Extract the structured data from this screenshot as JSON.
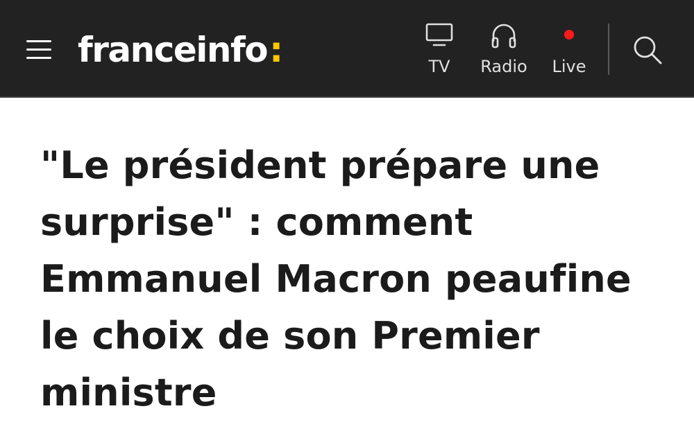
{
  "header": {
    "logo_text": "franceinfo",
    "logo_colon": ":",
    "menu_icon": "hamburger-menu-icon",
    "search_icon": "magnifier-icon",
    "nav": [
      {
        "label": "TV",
        "icon": "tv-icon"
      },
      {
        "label": "Radio",
        "icon": "headphones-icon"
      },
      {
        "label": "Live",
        "icon": "live-dot-icon"
      }
    ]
  },
  "article": {
    "headline": "\"Le président prépare une surprise\" : comment Emmanuel Macron peaufine le choix de son Premier ministre"
  },
  "colors": {
    "header_bg": "#222222",
    "logo_accent": "#fdc800",
    "live_dot": "#ff1a1a",
    "headline_text": "#1b1b1b"
  }
}
